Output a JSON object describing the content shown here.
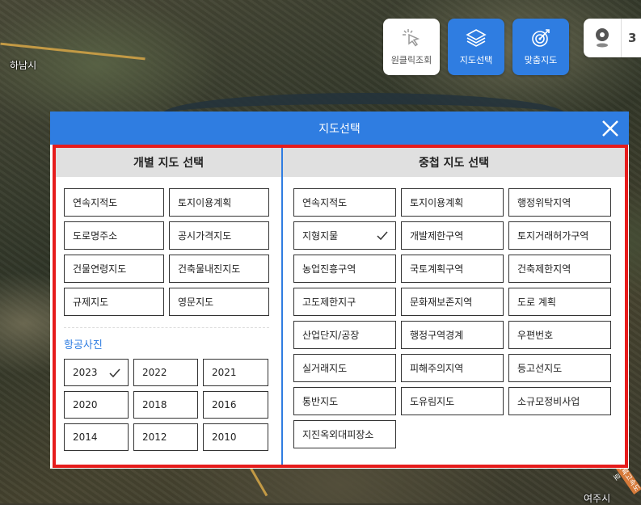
{
  "map": {
    "places": [
      "하남시",
      "여주시"
    ],
    "road_tag": "중부내륙고속도로"
  },
  "toolbar": {
    "oneclick_label": "원클릭조회",
    "mapselect_label": "지도선택",
    "custom_label": "맞춤지도",
    "edge_label": "3"
  },
  "dialog": {
    "title": "지도선택",
    "left_header": "개별 지도 선택",
    "right_header": "중첩 지도 선택",
    "individual_maps": [
      {
        "label": "연속지적도",
        "checked": false
      },
      {
        "label": "토지이용계획",
        "checked": false
      },
      {
        "label": "도로명주소",
        "checked": false
      },
      {
        "label": "공시가격지도",
        "checked": false
      },
      {
        "label": "건물연령지도",
        "checked": false
      },
      {
        "label": "건축물내진지도",
        "checked": false
      },
      {
        "label": "규제지도",
        "checked": false
      },
      {
        "label": "영문지도",
        "checked": false
      }
    ],
    "aerial_label": "항공사진",
    "years": [
      {
        "label": "2023",
        "checked": true
      },
      {
        "label": "2022",
        "checked": false
      },
      {
        "label": "2021",
        "checked": false
      },
      {
        "label": "2020",
        "checked": false
      },
      {
        "label": "2018",
        "checked": false
      },
      {
        "label": "2016",
        "checked": false
      },
      {
        "label": "2014",
        "checked": false
      },
      {
        "label": "2012",
        "checked": false
      },
      {
        "label": "2010",
        "checked": false
      }
    ],
    "overlay_maps": [
      {
        "label": "연속지적도",
        "checked": false
      },
      {
        "label": "토지이용계획",
        "checked": false
      },
      {
        "label": "행정위탁지역",
        "checked": false
      },
      {
        "label": "지형지물",
        "checked": true
      },
      {
        "label": "개발제한구역",
        "checked": false
      },
      {
        "label": "토지거래허가구역",
        "checked": false
      },
      {
        "label": "농업진흥구역",
        "checked": false
      },
      {
        "label": "국토계획구역",
        "checked": false
      },
      {
        "label": "건축제한지역",
        "checked": false
      },
      {
        "label": "고도제한지구",
        "checked": false
      },
      {
        "label": "문화재보존지역",
        "checked": false
      },
      {
        "label": "도로 계획",
        "checked": false
      },
      {
        "label": "산업단지/공장",
        "checked": false
      },
      {
        "label": "행정구역경계",
        "checked": false
      },
      {
        "label": "우편번호",
        "checked": false
      },
      {
        "label": "실거래지도",
        "checked": false
      },
      {
        "label": "피해주의지역",
        "checked": false
      },
      {
        "label": "등고선지도",
        "checked": false
      },
      {
        "label": "통반지도",
        "checked": false
      },
      {
        "label": "도유림지도",
        "checked": false
      },
      {
        "label": "소규모정비사업",
        "checked": false
      },
      {
        "label": "지진옥외대피장소",
        "checked": false
      }
    ]
  },
  "colors": {
    "accent": "#2f7de1",
    "highlight_border": "#e61c1c"
  }
}
